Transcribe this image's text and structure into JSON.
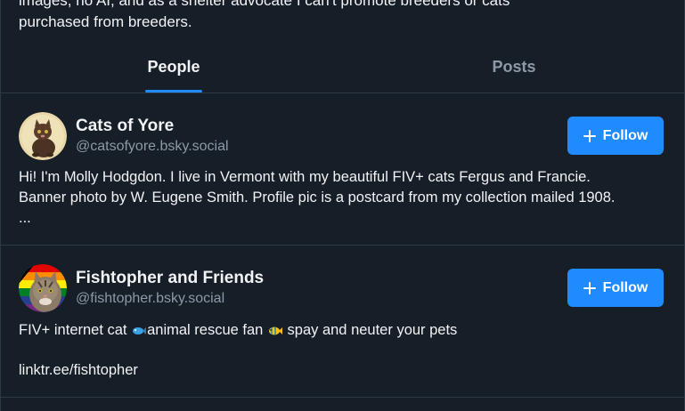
{
  "header": {
    "description_partial_line1": "images, no AI, and as a shelter advocate I can't promote breeders or cats",
    "description_line2": "purchased from breeders."
  },
  "tabs": [
    {
      "label": "People",
      "active": true
    },
    {
      "label": "Posts",
      "active": false
    }
  ],
  "profiles": [
    {
      "name": "Cats of Yore",
      "handle": "@catsofyore.bsky.social",
      "follow_label": "Follow",
      "bio_line1": "Hi! I'm Molly Hodgdon. I live in Vermont with my beautiful FIV+ cats Fergus and Francie.",
      "bio_line2": "Banner photo by W. Eugene Smith. Profile pic is a postcard from my collection mailed 1908.",
      "bio_line3": "...",
      "avatar_icon": "vintage-cat-postcard"
    },
    {
      "name": "Fishtopher and Friends",
      "handle": "@fishtopher.bsky.social",
      "follow_label": "Follow",
      "bio_part1": "FIV+ internet cat ",
      "bio_part2": "animal rescue fan ",
      "bio_part3": " spay and neuter your pets",
      "bio_link": "linktr.ee/fishtopher",
      "avatar_icon": "tabby-cat-pride-flag"
    }
  ],
  "colors": {
    "background": "#161e27",
    "accent": "#208bfe",
    "text_primary": "#f1f3f5",
    "text_secondary": "#8d99a7",
    "divider": "#2e3a48"
  }
}
